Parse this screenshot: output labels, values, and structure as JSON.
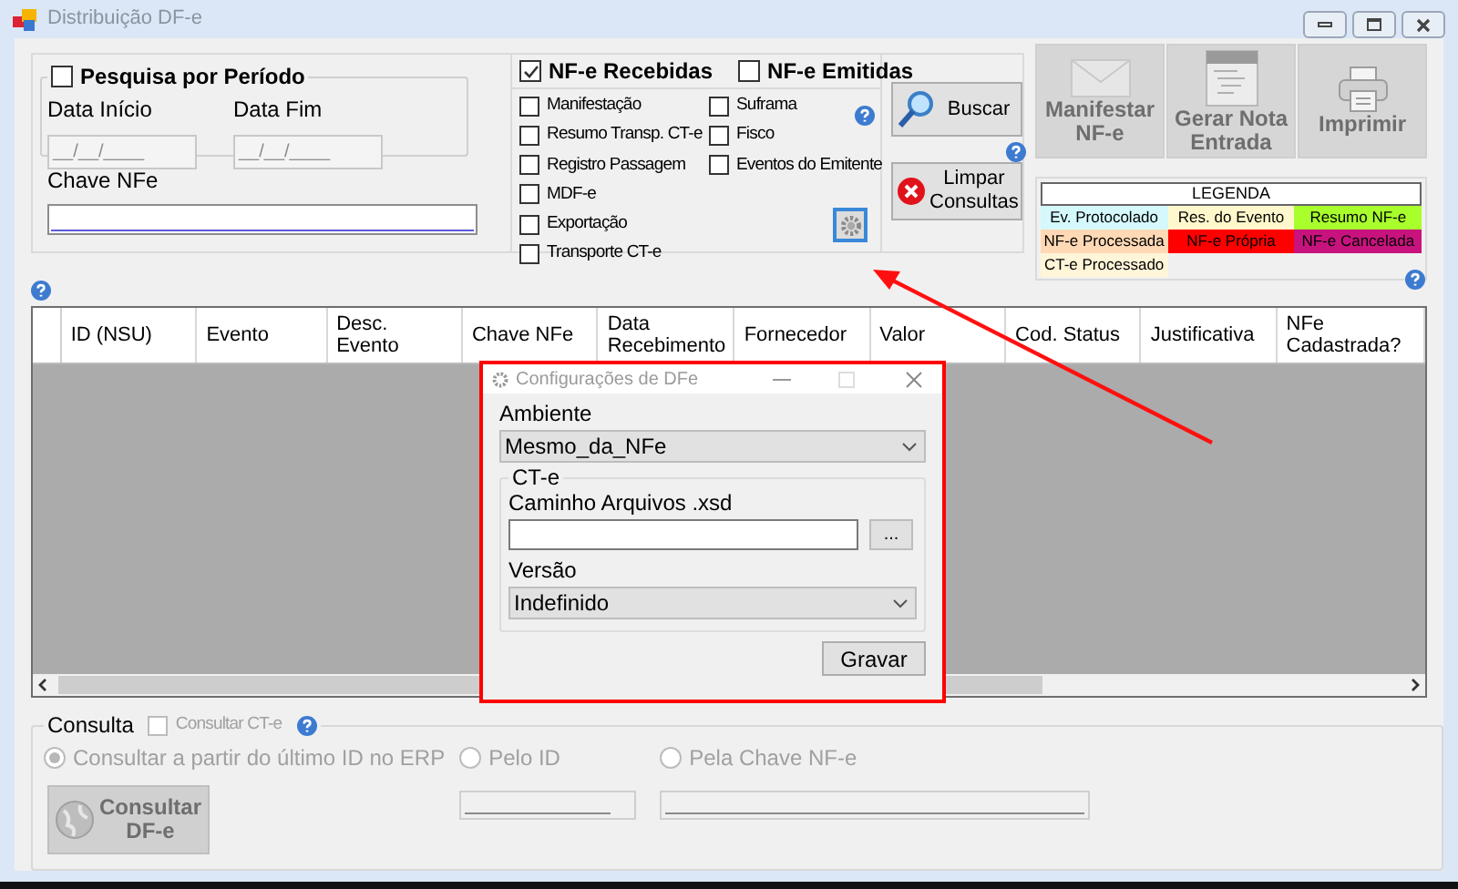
{
  "window": {
    "title": "Distribuição DF-e"
  },
  "periodo": {
    "label": "Pesquisa por Período",
    "checked": false,
    "inicio": {
      "label": "Data Início",
      "placeholder": "__/__/____"
    },
    "fim": {
      "label": "Data Fim",
      "placeholder": "__/__/____"
    }
  },
  "chave_nfe": {
    "label": "Chave NFe"
  },
  "nfe_tipos": [
    {
      "label": "NF-e Recebidas",
      "checked": true
    },
    {
      "label": "NF-e Emitidas",
      "checked": false
    }
  ],
  "eventos_col1": [
    {
      "label": "Manifestação",
      "checked": false
    },
    {
      "label": "Resumo Transp. CT-e",
      "checked": false
    },
    {
      "label": "Registro Passagem",
      "checked": false
    },
    {
      "label": "MDF-e",
      "checked": false
    },
    {
      "label": "Exportação",
      "checked": false
    },
    {
      "label": "Transporte CT-e",
      "checked": false
    }
  ],
  "eventos_col2": [
    {
      "label": "Suframa",
      "checked": false
    },
    {
      "label": "Fisco",
      "checked": false
    },
    {
      "label": "Eventos do Emitente",
      "checked": false
    }
  ],
  "buttons": [
    {
      "label": "Buscar",
      "kind": "search"
    },
    {
      "label": "Limpar Consultas",
      "kind": "clear"
    }
  ],
  "actions": [
    {
      "label": "Manifestar NF-e",
      "kind": "envelope",
      "disabled": true
    },
    {
      "label": "Gerar Nota Entrada",
      "kind": "xml",
      "disabled": true
    },
    {
      "label": "Imprimir",
      "kind": "printer",
      "disabled": true
    }
  ],
  "legend": {
    "title": "LEGENDA",
    "items": [
      {
        "label": "Ev. Protocolado",
        "color": "#d4f8fc"
      },
      {
        "label": "Res. do Evento",
        "color": "#fff8cc"
      },
      {
        "label": "Resumo NF-e",
        "color": "#a8ff2c"
      },
      {
        "label": "NF-e Processada",
        "color": "#ffd9b5"
      },
      {
        "label": "NF-e Própria",
        "color": "#ff0000"
      },
      {
        "label": "NF-e Cancelada",
        "color": "#c8137e"
      },
      {
        "label": "CT-e Processado",
        "color": "#fff5d8"
      }
    ]
  },
  "table": {
    "columns": [
      "ID (NSU)",
      "Evento",
      "Desc. Evento",
      "Chave NFe",
      "Data Recebimento",
      "Fornecedor",
      "Valor",
      "Cod. Status",
      "Justificativa",
      "NFe Cadastrada?"
    ]
  },
  "dialog": {
    "title": "Configurações de DFe",
    "ambiente": {
      "label": "Ambiente",
      "value": "Mesmo_da_NFe"
    },
    "group": "CT-e",
    "caminho": {
      "label": "Caminho Arquivos .xsd",
      "browse": "..."
    },
    "versao": {
      "label": "Versão",
      "value": "Indefinido"
    },
    "save": "Gravar"
  },
  "consulta": {
    "title": "Consulta",
    "disabled": true,
    "consultar_cte": {
      "label": "Consultar CT-e",
      "checked": false
    },
    "modes": [
      {
        "label": "Consultar a partir do último ID no ERP",
        "selected": true
      },
      {
        "label": "Pelo ID",
        "selected": false
      },
      {
        "label": "Pela Chave NF-e",
        "selected": false
      }
    ],
    "button": "Consultar DF-e"
  }
}
